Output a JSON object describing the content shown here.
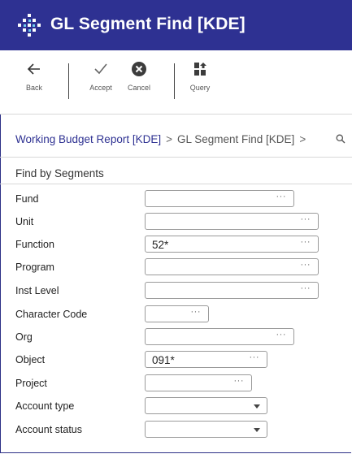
{
  "window": {
    "title": "GL Segment Find [KDE]"
  },
  "toolbar": {
    "back_label": "Back",
    "accept_label": "Accept",
    "cancel_label": "Cancel",
    "query_label": "Query"
  },
  "breadcrumb": {
    "items": [
      "Working Budget Report [KDE]",
      "GL Segment Find [KDE]"
    ],
    "separator": ">"
  },
  "section": {
    "title": "Find by Segments"
  },
  "fields": {
    "fund": {
      "label": "Fund",
      "value": ""
    },
    "unit": {
      "label": "Unit",
      "value": ""
    },
    "function": {
      "label": "Function",
      "value": "52*"
    },
    "program": {
      "label": "Program",
      "value": ""
    },
    "inst_level": {
      "label": "Inst Level",
      "value": ""
    },
    "character_code": {
      "label": "Character Code",
      "value": ""
    },
    "org": {
      "label": "Org",
      "value": ""
    },
    "object": {
      "label": "Object",
      "value": "091*"
    },
    "project": {
      "label": "Project",
      "value": ""
    },
    "account_type": {
      "label": "Account type",
      "value": ""
    },
    "account_status": {
      "label": "Account status",
      "value": ""
    }
  },
  "lookup_glyph": "···",
  "icons": [
    "app-logo-icon",
    "back-arrow-icon",
    "checkmark-icon",
    "cancel-x-icon",
    "query-icon",
    "search-icon"
  ],
  "colors": {
    "header_bg": "#2e3192",
    "link": "#2e3192",
    "field_border": "#9a9a9a"
  }
}
